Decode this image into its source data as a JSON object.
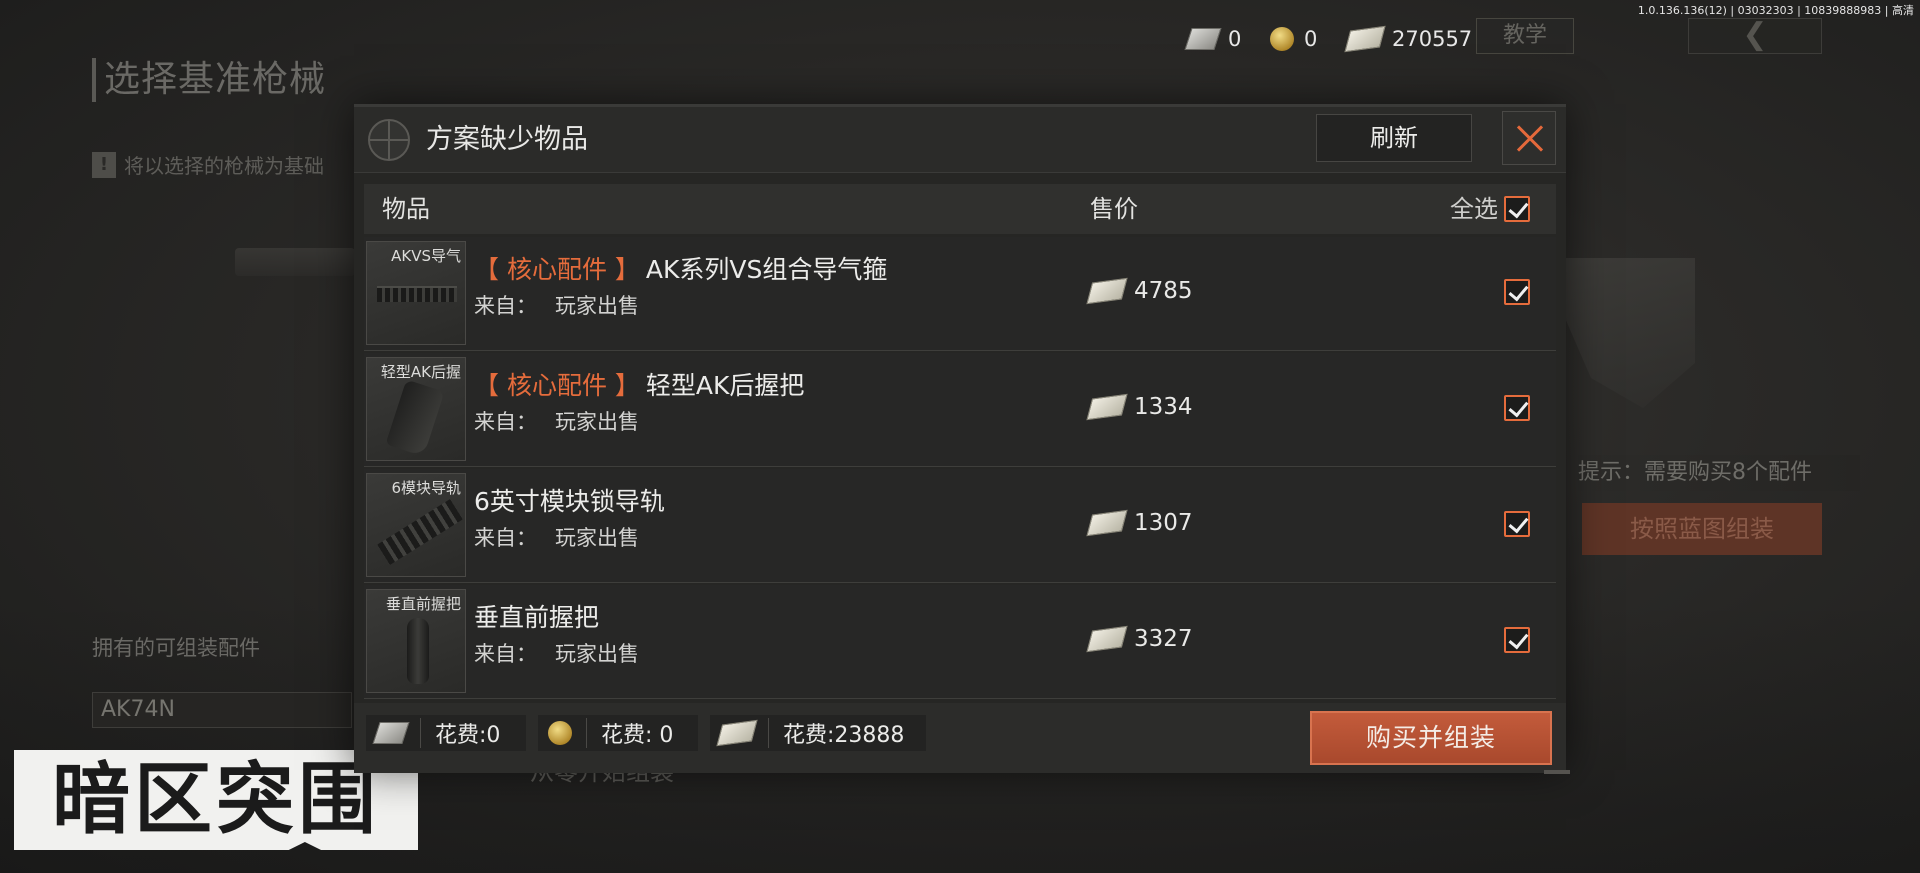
{
  "version_info": "1.0.136.136(12) | 03032303 | 10839888983 | 高清",
  "currencies": [
    {
      "icon": "voucher-icon",
      "value": "0"
    },
    {
      "icon": "coin-icon",
      "value": "0"
    },
    {
      "icon": "cash-icon",
      "value": "270557"
    }
  ],
  "top_bar": {
    "tutorial_label": "教学",
    "back_symbol": "❮"
  },
  "background": {
    "page_title": "选择基准枪械",
    "note_text": "将以选择的枪械为基础",
    "note_icon": "!",
    "hint_text": "提示：需要购买8个配件",
    "blueprint_button": "按照蓝图组装",
    "owned_label": "拥有的可组装配件",
    "owned_item": "AK74N",
    "scratch_label": "从零开始组装"
  },
  "logo_text": "暗区突围",
  "dialog": {
    "title": "方案缺少物品",
    "refresh_label": "刷新",
    "table_headers": {
      "item": "物品",
      "price": "售价",
      "select_all": "全选"
    },
    "source_label": "来自：",
    "items": [
      {
        "thumb_label": "AKVS导气",
        "core_tag": "【 核心配件 】",
        "name": "AK系列VS组合导气箍",
        "source": "玩家出售",
        "price": "4785",
        "checked": true
      },
      {
        "thumb_label": "轻型AK后握",
        "core_tag": "【 核心配件 】",
        "name": "轻型AK后握把",
        "source": "玩家出售",
        "price": "1334",
        "checked": true
      },
      {
        "thumb_label": "6模块导轨",
        "core_tag": "",
        "name": "6英寸模块锁导轨",
        "source": "玩家出售",
        "price": "1307",
        "checked": true
      },
      {
        "thumb_label": "垂直前握把",
        "core_tag": "",
        "name": "垂直前握把",
        "source": "玩家出售",
        "price": "3327",
        "checked": true
      }
    ],
    "costs": [
      {
        "icon": "voucher-icon",
        "label": "花费:0"
      },
      {
        "icon": "coin-icon",
        "label": "花费: 0"
      },
      {
        "icon": "cash-icon",
        "label": "花费:23888"
      }
    ],
    "buy_button": "购买并组装"
  },
  "colors": {
    "accent": "#e56c3c",
    "buy_button": "#b9533a",
    "panel": "#262624"
  }
}
